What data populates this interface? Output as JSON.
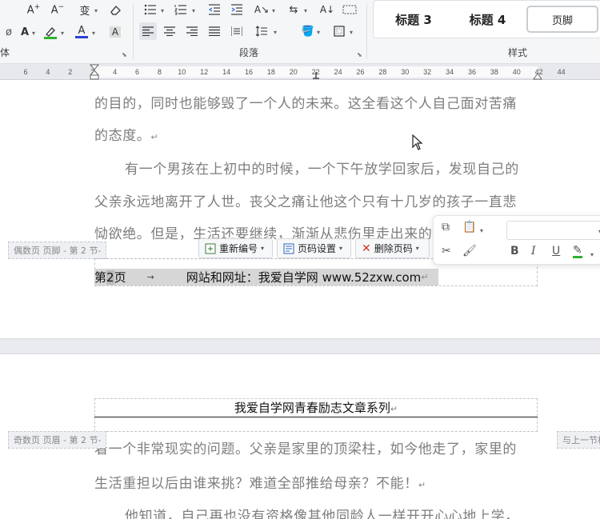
{
  "ribbon": {
    "font_group": {
      "label_fragment": "体",
      "font_color_hex": "#2b3fd6",
      "highlight_color_hex": "#2fb12f"
    },
    "paragraph_group": {
      "label": "段落"
    },
    "styles_group": {
      "label": "样式",
      "items": [
        "标题 3",
        "标题 4",
        "页脚"
      ]
    }
  },
  "ruler": {
    "ticks": [
      "6",
      "4",
      "2",
      "2",
      "4",
      "6",
      "8",
      "10",
      "12",
      "14",
      "16",
      "18",
      "20",
      "22",
      "24",
      "26",
      "28",
      "30",
      "32",
      "34",
      "36",
      "38",
      "40",
      "42",
      "44"
    ]
  },
  "document": {
    "page1_paragraphs": [
      "的目的，同时也能够毁了一个人的未来。这全看这个人自己面对苦痛",
      "的态度。",
      "有一个男孩在上初中的时候，一个下午放学回家后，发现自己的",
      "父亲永远地离开了人世。丧父之痛让他这个只有十几岁的孩子一直悲",
      "恸欲绝。但是，生活还要继续，渐渐从悲伤里走出来的他，立即面临"
    ],
    "footer": {
      "tag": "偶数页 页脚 - 第 2 节-",
      "text_prefix": "第 ",
      "page_num": "2",
      "text_suffix": "页",
      "tab_arrow": "→",
      "site_text": "网站和网址：我爱自学网 www.52zxw.com",
      "buttons": {
        "renumber": "重新编号",
        "page_setup": "页码设置",
        "delete": "删除页码"
      }
    },
    "page2_header": {
      "tag": "奇数页 页眉 - 第 2 节-",
      "link_prev": "与上一节相",
      "text": "我爱自学网青春励志文章系列"
    },
    "page2_paragraphs": [
      "着一个非常现实的问题。父亲是家里的顶梁柱，如今他走了，家里的",
      "生活重担以后由谁来挑？难道全部推给母亲？不能！",
      "他知道，自己再也没有资格像其他同龄人一样开开心心地上学，"
    ],
    "paragraph_mark": "↵"
  }
}
